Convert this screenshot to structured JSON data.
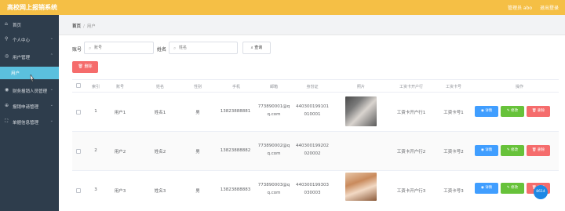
{
  "app": {
    "title": "高校网上报销系统"
  },
  "topbar": {
    "user": "管理员 abo",
    "logout": "退出登录"
  },
  "sidebar": {
    "items": [
      {
        "label": "首页",
        "icon": "home-icon"
      },
      {
        "label": "个人中心",
        "icon": "user-icon"
      },
      {
        "label": "用户管理",
        "icon": "users-icon"
      },
      {
        "label": "财务报销人员管理",
        "icon": "finance-icon"
      },
      {
        "label": "报销申请管理",
        "icon": "apply-icon"
      },
      {
        "label": "单据信息管理",
        "icon": "document-icon"
      }
    ],
    "sub_item": "用户"
  },
  "breadcrumb": {
    "home": "首页",
    "current": "用户"
  },
  "search": {
    "label1": "账号",
    "placeholder1": "账号",
    "label2": "姓名",
    "placeholder2": "姓名",
    "button": "查询"
  },
  "toolbar": {
    "delete_label": "删除"
  },
  "table": {
    "headers": [
      "索引",
      "账号",
      "姓名",
      "性别",
      "手机",
      "邮箱",
      "身份证",
      "照片",
      "工资卡开户行",
      "工资卡号",
      "操作"
    ],
    "rows": [
      {
        "index": "1",
        "account": "用户1",
        "name": "姓名1",
        "gender": "男",
        "phone": "13823888881",
        "email1": "773890001@q",
        "email2": "q.com",
        "id1": "440300199101",
        "id2": "010001",
        "bank": "工资卡开户行1",
        "card": "工资卡号1"
      },
      {
        "index": "2",
        "account": "用户2",
        "name": "姓名2",
        "gender": "男",
        "phone": "13823888882",
        "email1": "773890002@q",
        "email2": "q.com",
        "id1": "440300199202",
        "id2": "020002",
        "bank": "工资卡开户行2",
        "card": "工资卡号2"
      },
      {
        "index": "3",
        "account": "用户3",
        "name": "姓名3",
        "gender": "男",
        "phone": "13823888883",
        "email1": "773890003@q",
        "email2": "q.com",
        "id1": "440300199303",
        "id2": "030003",
        "bank": "工资卡开户行3",
        "card": "工资卡号3"
      }
    ],
    "actions": {
      "detail": "详情",
      "edit": "修改",
      "delete": "删除"
    }
  },
  "chat": {
    "badge": "8614"
  }
}
